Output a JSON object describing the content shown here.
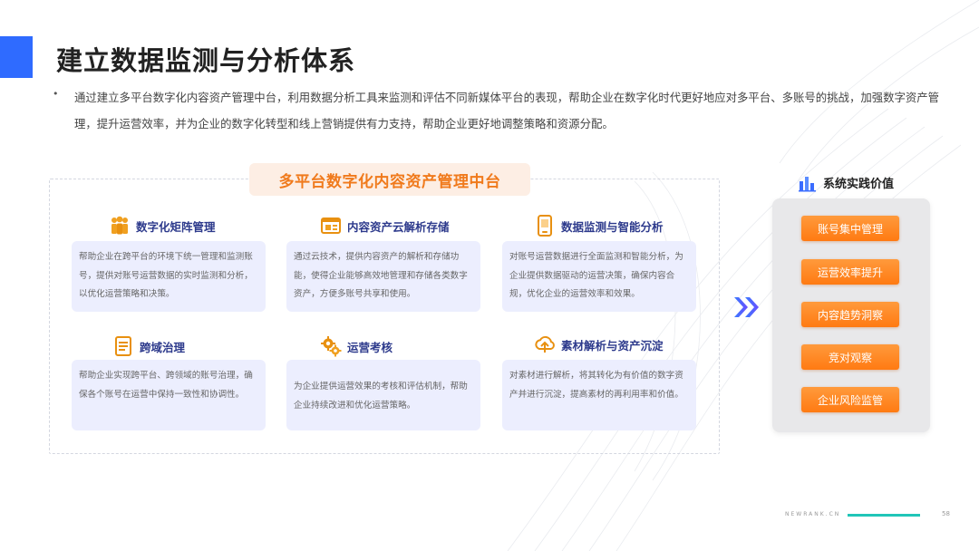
{
  "title": "建立数据监测与分析体系",
  "intro": "通过建立多平台数字化内容资产管理中台，利用数据分析工具来监测和评估不同新媒体平台的表现，帮助企业在数字化时代更好地应对多平台、多账号的挑战，加强数字资产管理，提升运营效率，并为企业的数字化转型和线上营销提供有力支持，帮助企业更好地调整策略和资源分配。",
  "center_title": "多平台数字化内容资产管理中台",
  "features": [
    {
      "title": "数字化矩阵管理",
      "icon": "people-group-icon",
      "desc": "帮助企业在跨平台的环境下统一管理和监测账号，提供对账号运营数据的实时监测和分析，以优化运营策略和决策。"
    },
    {
      "title": "内容资产云解析存储",
      "icon": "browser-window-icon",
      "desc": "通过云技术，提供内容资产的解析和存储功能，使得企业能够高效地管理和存储各类数字资产，方便多账号共享和使用。"
    },
    {
      "title": "数据监测与智能分析",
      "icon": "mobile-phone-icon",
      "desc": "对账号运营数据进行全面监测和智能分析，为企业提供数据驱动的运营决策，确保内容合规，优化企业的运营效率和效果。"
    },
    {
      "title": "跨域治理",
      "icon": "document-list-icon",
      "desc": "帮助企业实现跨平台、跨领域的账号治理，确保各个账号在运营中保持一致性和协调性。"
    },
    {
      "title": "运营考核",
      "icon": "gears-icon",
      "desc": "为企业提供运营效果的考核和评估机制，帮助企业持续改进和优化运营策略。"
    },
    {
      "title": "素材解析与资产沉淀",
      "icon": "cloud-icon",
      "desc": "对素材进行解析，将其转化为有价值的数字资产并进行沉淀，提高素材的再利用率和价值。"
    }
  ],
  "value": {
    "title": "系统实践价值",
    "icon": "bar-chart-icon",
    "items": [
      "账号集中管理",
      "运营效率提升",
      "内容趋势洞察",
      "竞对观察",
      "企业风险监管"
    ]
  },
  "footer": {
    "brand": "NEWRANK.CN",
    "page": "58"
  },
  "colors": {
    "accent_blue": "#2f6bff",
    "orange": "#f07a1c",
    "card_bg": "#eceefe",
    "heading_navy": "#2d3a8c",
    "teal": "#21c5b8"
  }
}
